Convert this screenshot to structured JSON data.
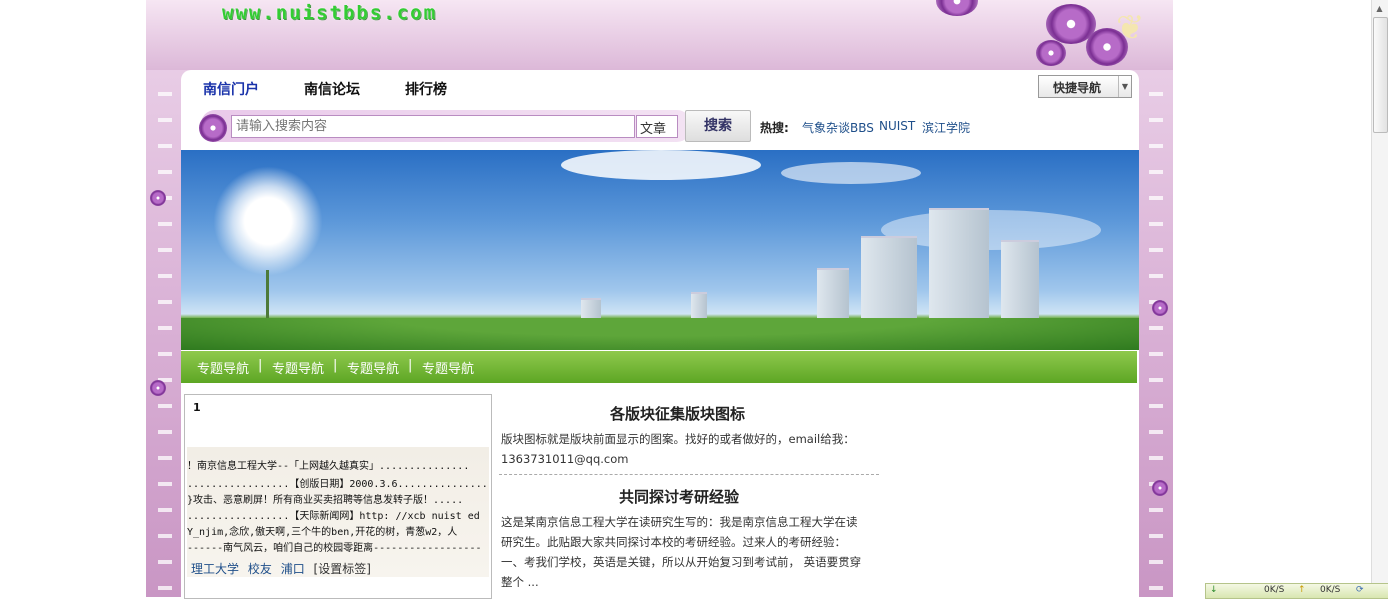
{
  "site": {
    "logo_text": "www.nuistbbs.com"
  },
  "nav": {
    "items": [
      {
        "label": "南信门户",
        "active": true
      },
      {
        "label": "南信论坛",
        "active": false
      },
      {
        "label": "排行榜",
        "active": false
      }
    ],
    "quick_nav_label": "快捷导航",
    "quick_nav_arrow_icon": "chevron-down-icon"
  },
  "search": {
    "placeholder": "请输入搜索内容",
    "type_value": "文章",
    "button_label": "搜索",
    "hot_label": "热搜:",
    "hot_links": [
      "气象杂谈BBS",
      "NUIST",
      "滨江学院"
    ]
  },
  "topic_bar": {
    "items": [
      "专题导航",
      "专题导航",
      "专题导航",
      "专题导航"
    ],
    "separator": "|"
  },
  "left_panel": {
    "number": "1",
    "marquee_lines": [
      "！南京信息工程大学--「上网越久越真实」...............",
      ".................【创版日期】2000.3.6...............",
      "}攻击、恶意刷屏！所有商业买卖招聘等信息发转子版！.....",
      ".................【天际新闻网】http: //xcb nuist ed",
      "Y_njim,念欣,傲天啊,三个牛的ben,开花的树，青葱w2，人",
      "------南气风云，咱们自己的校园零距离------------------"
    ],
    "tags": [
      "理工大学",
      "校友",
      "浦口"
    ],
    "tags_setting": "[设置标签]"
  },
  "articles": [
    {
      "title": "各版块征集版块图标",
      "body_lines": [
        "版块图标就是版块前面显示的图案。找好的或者做好的，email给我：",
        "1363731011@qq.com"
      ]
    },
    {
      "title": "共同探讨考研经验",
      "body_lines": [
        "这是某南京信息工程大学在读研究生写的：我是南京信息工程大学在读",
        "研究生。此贴跟大家共同探讨本校的考研经验。过来人的考研经验：",
        "一、考我们学校，英语是关键，所以从开始复习到考试前， 英语要贯穿",
        "整个 ..."
      ]
    }
  ],
  "statusbar": {
    "down": "0K/S",
    "up": "0K/S"
  },
  "colors": {
    "accent_purple": "#b76bc8",
    "topic_green": "#5da624",
    "link_blue": "#1f4f8a"
  }
}
